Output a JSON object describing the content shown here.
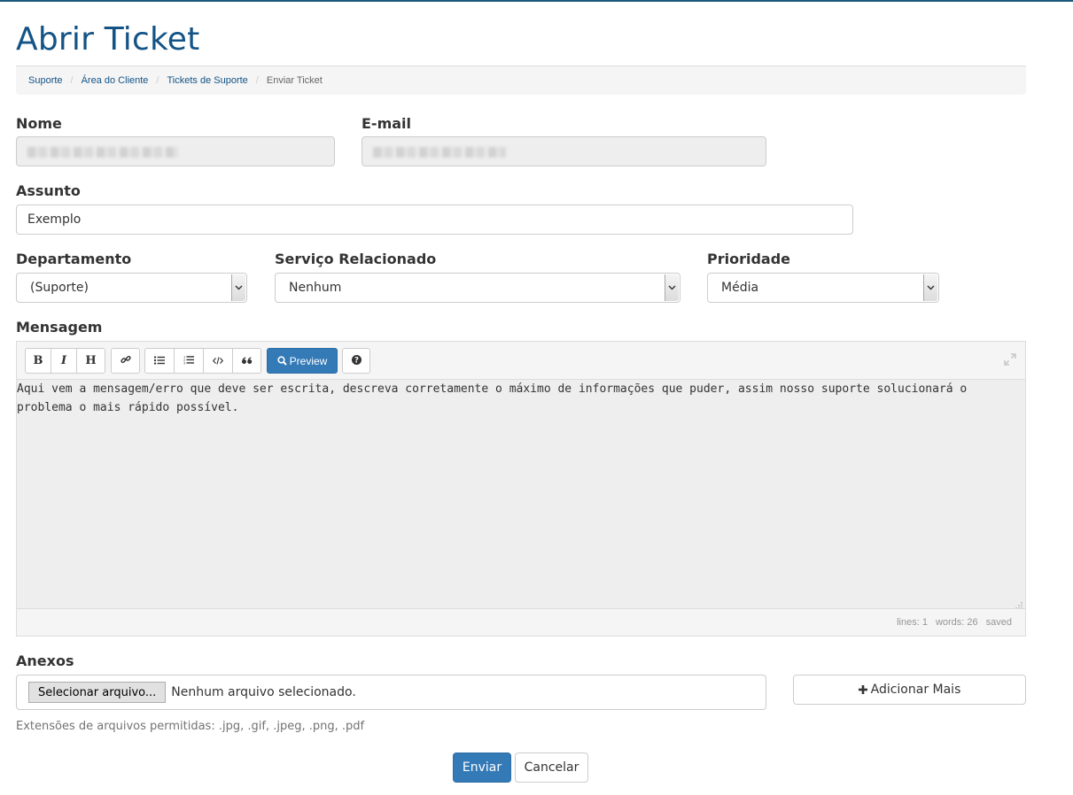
{
  "page": {
    "title": "Abrir Ticket"
  },
  "breadcrumb": {
    "items": [
      {
        "label": "Suporte"
      },
      {
        "label": "Área do Cliente"
      },
      {
        "label": "Tickets de Suporte"
      },
      {
        "label": "Enviar Ticket"
      }
    ]
  },
  "form": {
    "name": {
      "label": "Nome",
      "value": ""
    },
    "email": {
      "label": "E-mail",
      "value": ""
    },
    "subject": {
      "label": "Assunto",
      "value": "Exemplo"
    },
    "department": {
      "label": "Departamento",
      "selected": "(Suporte)"
    },
    "related_service": {
      "label": "Serviço Relacionado",
      "selected": "Nenhum"
    },
    "priority": {
      "label": "Prioridade",
      "selected": "Média"
    },
    "message": {
      "label": "Mensagem",
      "value": "Aqui vem a mensagem/erro que deve ser escrita, descreva corretamente o máximo de informações que puder, assim nosso suporte solucionará o problema o mais rápido possível."
    },
    "editor": {
      "bold_label": "B",
      "italic_label": "I",
      "heading_label": "H",
      "preview_label": "Preview",
      "status_lines": "lines: 1",
      "status_words": "words: 26",
      "status_saved": "saved"
    },
    "attachments": {
      "label": "Anexos",
      "choose_label": "Selecionar arquivo...",
      "no_file_text": "Nenhum arquivo selecionado.",
      "add_more_label": "Adicionar Mais",
      "allowed_text": "Extensões de arquivos permitidas: .jpg, .gif, .jpeg, .png, .pdf"
    },
    "submit_label": "Enviar",
    "cancel_label": "Cancelar"
  },
  "colors": {
    "accent": "#337ab7",
    "title": "#135386",
    "link": "#135386"
  },
  "icons": [
    "link-icon",
    "unordered-list-icon",
    "ordered-list-icon",
    "code-icon",
    "quote-icon",
    "search-icon",
    "help-icon",
    "fullscreen-icon",
    "resize-handle-icon",
    "plus-icon",
    "chevron-down-icon"
  ]
}
